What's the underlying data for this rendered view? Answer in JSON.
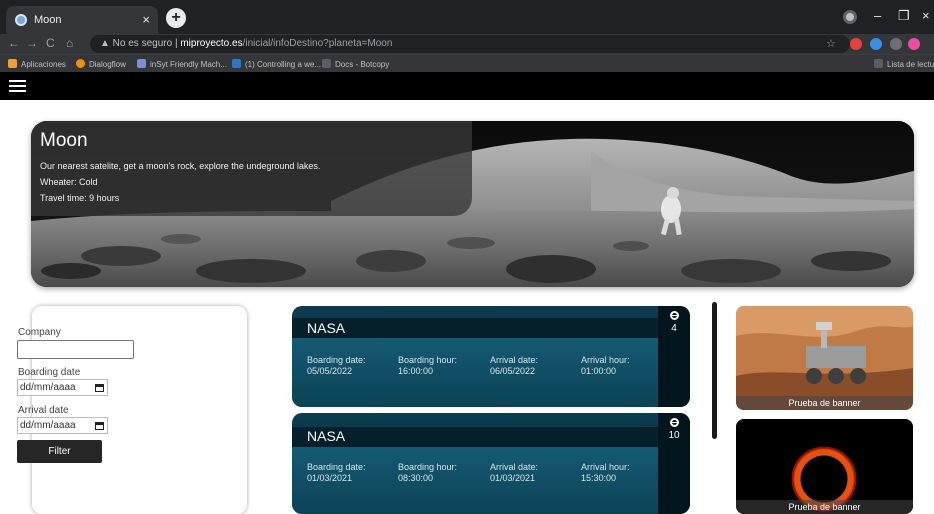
{
  "browser": {
    "tab_title": "Moon",
    "tab_close": "×",
    "new_tab": "+",
    "url_warning": "▲ No es seguro",
    "url_host": "miproyecto.es",
    "url_path": "/inicial/infoDestino?planeta=Moon",
    "bookmarks": [
      {
        "label": "Aplicaciones",
        "color": "#e8a23a"
      },
      {
        "label": "Dialogflow",
        "color": "#f29100"
      },
      {
        "label": "inSyt Friendly Mach...",
        "color": "#7b8fd8"
      },
      {
        "label": "(1) Controlling a we...",
        "color": "#2f77c4"
      },
      {
        "label": "Docs - Botcopy",
        "color": "#5a5d63"
      }
    ],
    "reading_list": "Lista de lectura"
  },
  "destination": {
    "title": "Moon",
    "description": "Our nearest satelite, get a moon's rock, explore the undeground lakes.",
    "weather": "Wheater: Cold",
    "travel_time": "Travel time: 9 hours"
  },
  "filter": {
    "company_label": "Company",
    "company_value": "",
    "boarding_label": "Boarding date",
    "boarding_placeholder": "dd/mm/aaaa",
    "arrival_label": "Arrival date",
    "arrival_placeholder": "dd/mm/aaaa",
    "button": "Filter"
  },
  "flight_labels": {
    "boarding_date": "Boarding date:",
    "boarding_hour": "Boarding hour:",
    "arrival_date": "Arrival date:",
    "arrival_hour": "Arrival hour:"
  },
  "flights": [
    {
      "company": "NASA",
      "seats": "4",
      "boarding_date": "05/05/2022",
      "boarding_hour": "16:00:00",
      "arrival_date": "06/05/2022",
      "arrival_hour": "01:00:00"
    },
    {
      "company": "NASA",
      "seats": "10",
      "boarding_date": "01/03/2021",
      "boarding_hour": "08:30:00",
      "arrival_date": "01/03/2021",
      "arrival_hour": "15:30:00"
    }
  ],
  "banners": [
    {
      "caption": "Prueba de banner"
    },
    {
      "caption": "Prueba de banner"
    }
  ]
}
